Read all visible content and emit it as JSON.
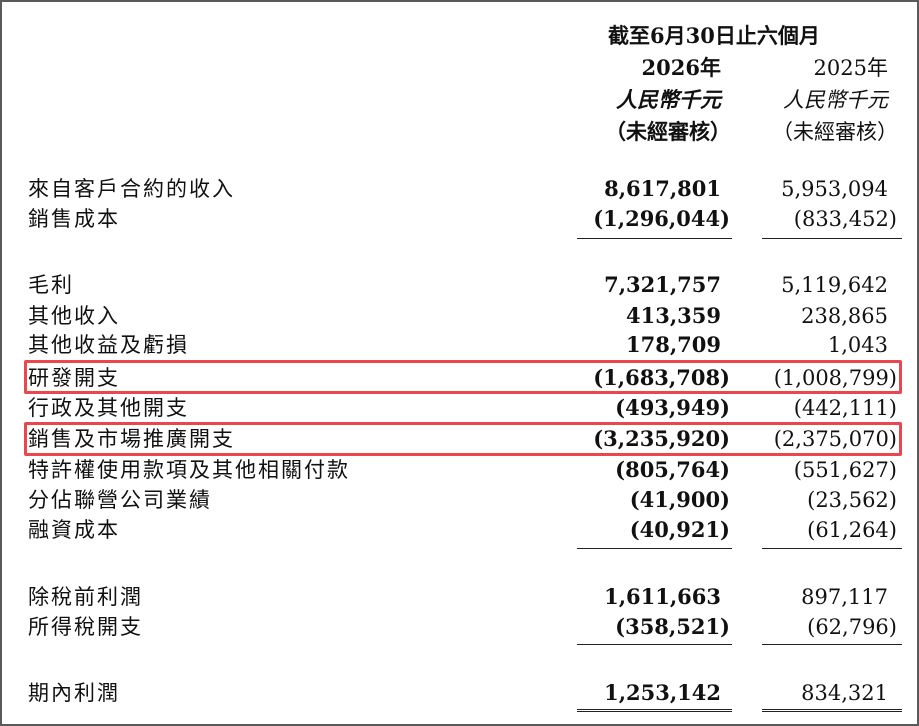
{
  "header": {
    "period": "截至6月30日止六個月",
    "year_current": "2026年",
    "year_prior": "2025年",
    "unit_current": "人民幣千元",
    "unit_prior": "人民幣千元",
    "audit_current": "（未經審核）",
    "audit_prior": "（未經審核）"
  },
  "rows": [
    {
      "label": "來自客戶合約的收入",
      "current": "8,617,801",
      "prior": "5,953,094"
    },
    {
      "label": "銷售成本",
      "current": "(1,296,044)",
      "prior": "(833,452)"
    },
    {
      "label": "毛利",
      "current": "7,321,757",
      "prior": "5,119,642"
    },
    {
      "label": "其他收入",
      "current": "413,359",
      "prior": "238,865"
    },
    {
      "label": "其他收益及虧損",
      "current": "178,709",
      "prior": "1,043"
    },
    {
      "label": "研發開支",
      "current": "(1,683,708)",
      "prior": "(1,008,799)"
    },
    {
      "label": "行政及其他開支",
      "current": "(493,949)",
      "prior": "(442,111)"
    },
    {
      "label": "銷售及市場推廣開支",
      "current": "(3,235,920)",
      "prior": "(2,375,070)"
    },
    {
      "label": "特許權使用款項及其他相關付款",
      "current": "(805,764)",
      "prior": "(551,627)"
    },
    {
      "label": "分佔聯營公司業績",
      "current": "(41,900)",
      "prior": "(23,562)"
    },
    {
      "label": "融資成本",
      "current": "(40,921)",
      "prior": "(61,264)"
    },
    {
      "label": "除稅前利潤",
      "current": "1,611,663",
      "prior": "897,117"
    },
    {
      "label": "所得稅開支",
      "current": "(358,521)",
      "prior": "(62,796)"
    },
    {
      "label": "期內利潤",
      "current": "1,253,142",
      "prior": "834,321"
    }
  ],
  "highlight_color": "#e8474f"
}
